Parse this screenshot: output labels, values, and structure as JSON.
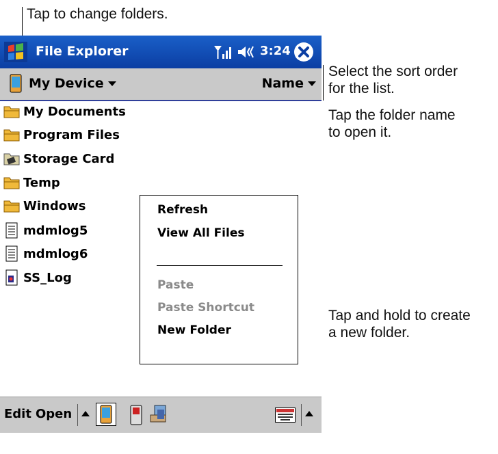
{
  "callouts": {
    "change_folders": "Tap to change folders.",
    "sort_order": [
      "Select the sort order",
      "for the list."
    ],
    "folder_name": [
      "Tap the folder name",
      "to open it."
    ],
    "new_folder": [
      "Tap and hold to create",
      "a new folder."
    ]
  },
  "titlebar": {
    "title": "File Explorer",
    "time": "3:24",
    "icons": [
      "start-flag-icon",
      "signal-icon",
      "volume-icon",
      "close-icon"
    ]
  },
  "toolbar": {
    "location": "My Device",
    "sort": "Name"
  },
  "files": [
    {
      "name": "My Documents",
      "icon": "folder-icon"
    },
    {
      "name": "Program Files",
      "icon": "folder-icon"
    },
    {
      "name": "Storage Card",
      "icon": "storage-card-icon"
    },
    {
      "name": "Temp",
      "icon": "folder-icon"
    },
    {
      "name": "Windows",
      "icon": "folder-icon"
    },
    {
      "name": "mdmlog5",
      "icon": "document-icon"
    },
    {
      "name": "mdmlog6",
      "icon": "document-icon"
    },
    {
      "name": "SS_Log",
      "icon": "log-file-icon"
    }
  ],
  "context_menu": {
    "items": [
      {
        "label": "Refresh",
        "enabled": true
      },
      {
        "label": "View All Files",
        "enabled": true
      },
      {
        "label": "Paste",
        "enabled": false
      },
      {
        "label": "Paste Shortcut",
        "enabled": false
      },
      {
        "label": "New Folder",
        "enabled": true
      }
    ]
  },
  "bottombar": {
    "edit": "Edit",
    "open": "Open"
  },
  "colors": {
    "titlebar": "#1a5fc8",
    "toolbar": "#c9c9c9",
    "disabled": "#8a8a8a",
    "folder": "#f0b93a"
  }
}
